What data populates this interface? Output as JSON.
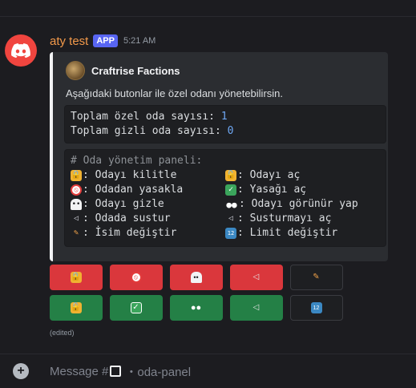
{
  "message": {
    "author": "aty test",
    "badge": "APP",
    "time": "5:21 AM",
    "edited": "(edited)"
  },
  "embed": {
    "author_name": "Craftrise Factions",
    "description": "Aşağıdaki butonlar ile özel odanı yönetebilirsin.",
    "stats": {
      "private_label": "Toplam özel oda sayısı: ",
      "private_value": "1",
      "hidden_label": "Toplam gizli oda sayısı: ",
      "hidden_value": "0"
    },
    "panel_title": "# Oda yönetim paneli:",
    "panel_rows": [
      {
        "left_icon": "lock-icon",
        "left": ": Odayı kilitle",
        "right_icon": "unlock-icon",
        "right": ": Odayı aç"
      },
      {
        "left_icon": "no-entry-icon",
        "left": ": Odadan yasakla",
        "right_icon": "check-icon",
        "right": ": Yasağı aç"
      },
      {
        "left_icon": "ghost-icon",
        "left": ": Odayı gizle",
        "right_icon": "eyes-icon",
        "right": ": Odayı görünür yap"
      },
      {
        "left_icon": "mute-icon",
        "left": ": Odada sustur",
        "right_icon": "speaker-icon",
        "right": ": Susturmayı aç"
      },
      {
        "left_icon": "pencil-icon",
        "left": ": İsim değiştir",
        "right_icon": "numbers-icon",
        "right": ": Limit değiştir"
      }
    ]
  },
  "buttons": {
    "row1": [
      "lock-icon",
      "no-entry-icon",
      "ghost-icon",
      "mute-icon",
      "pencil-icon"
    ],
    "row2": [
      "unlock-icon",
      "check-icon",
      "eyes-icon",
      "speaker-icon",
      "numbers-icon"
    ]
  },
  "composer": {
    "prefix": "Message #",
    "channel": "・oda-panel"
  },
  "colors": {
    "background": "#1c1c20",
    "username": "#f2994a",
    "app_badge": "#5865f2",
    "danger_button": "#da373c",
    "success_button": "#248046",
    "secondary_button": "#1e1f22"
  }
}
